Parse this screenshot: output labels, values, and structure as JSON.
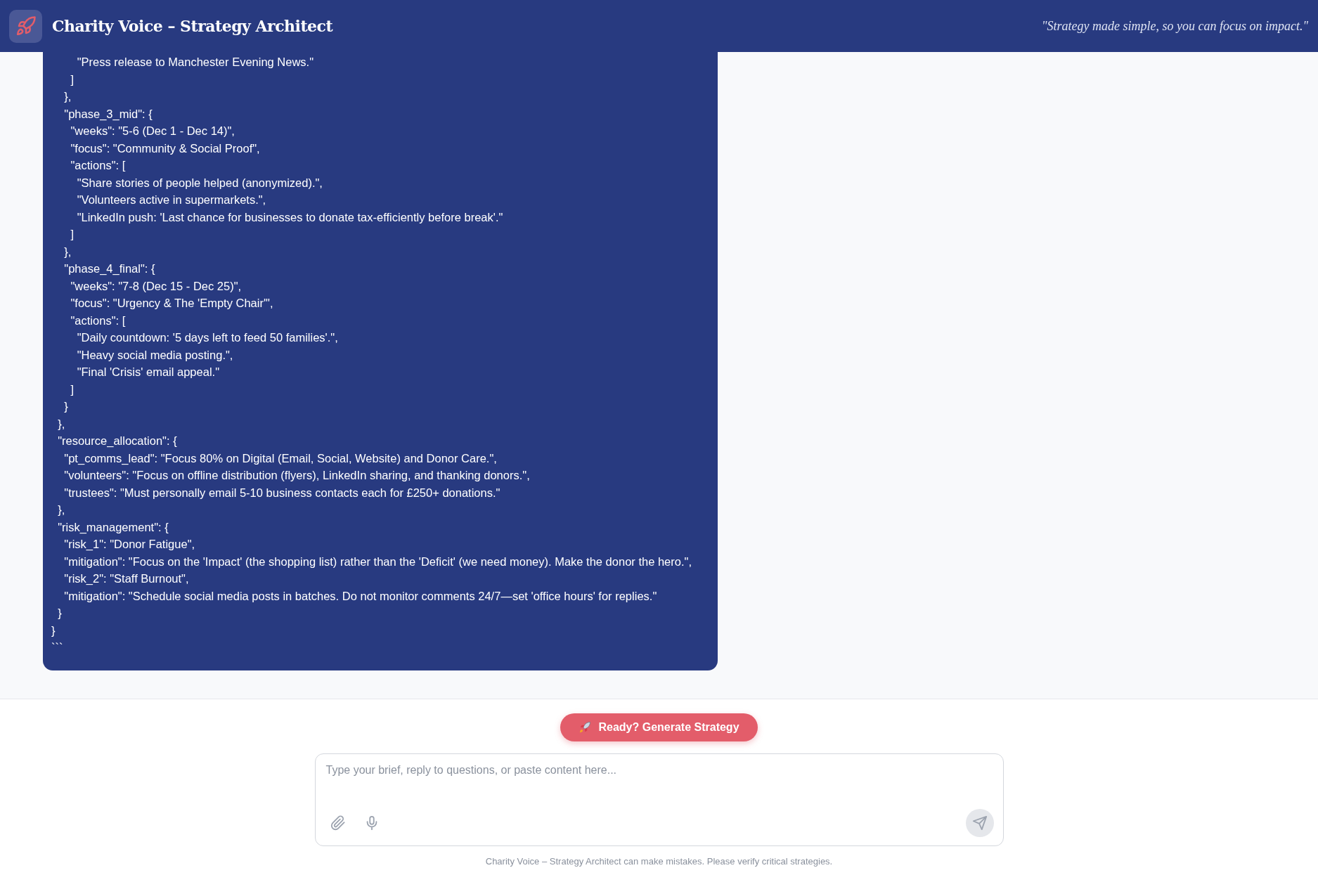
{
  "header": {
    "title": "Charity Voice – Strategy Architect",
    "tagline": "\"Strategy made simple, so you can focus on impact.\""
  },
  "message": {
    "code_lines": [
      "        \"Press release to Manchester Evening News.\"",
      "      ]",
      "    },",
      "    \"phase_3_mid\": {",
      "      \"weeks\": \"5-6 (Dec 1 - Dec 14)\",",
      "      \"focus\": \"Community & Social Proof\",",
      "      \"actions\": [",
      "        \"Share stories of people helped (anonymized).\",",
      "        \"Volunteers active in supermarkets.\",",
      "        \"LinkedIn push: 'Last chance for businesses to donate tax-efficiently before break'.\"",
      "      ]",
      "    },",
      "    \"phase_4_final\": {",
      "      \"weeks\": \"7-8 (Dec 15 - Dec 25)\",",
      "      \"focus\": \"Urgency & The 'Empty Chair'\",",
      "      \"actions\": [",
      "        \"Daily countdown: '5 days left to feed 50 families'.\",",
      "        \"Heavy social media posting.\",",
      "        \"Final 'Crisis' email appeal.\"",
      "      ]",
      "    }",
      "  },",
      "  \"resource_allocation\": {",
      "    \"pt_comms_lead\": \"Focus 80% on Digital (Email, Social, Website) and Donor Care.\",",
      "    \"volunteers\": \"Focus on offline distribution (flyers), LinkedIn sharing, and thanking donors.\",",
      "    \"trustees\": \"Must personally email 5-10 business contacts each for £250+ donations.\"",
      "  },",
      "  \"risk_management\": {",
      "    \"risk_1\": \"Donor Fatigue\",",
      "    \"mitigation\": \"Focus on the 'Impact' (the shopping list) rather than the 'Deficit' (we need money). Make the donor the hero.\",",
      "    \"risk_2\": \"Staff Burnout\",",
      "    \"mitigation\": \"Schedule social media posts in batches. Do not monitor comments 24/7—set 'office hours' for replies.\"",
      "  }",
      "}",
      "```"
    ]
  },
  "generate_button": {
    "label": "Ready? Generate Strategy"
  },
  "composer": {
    "placeholder": "Type your brief, reply to questions, or paste content here..."
  },
  "disclaimer": "Charity Voice – Strategy Architect can make mistakes. Please verify critical strategies."
}
